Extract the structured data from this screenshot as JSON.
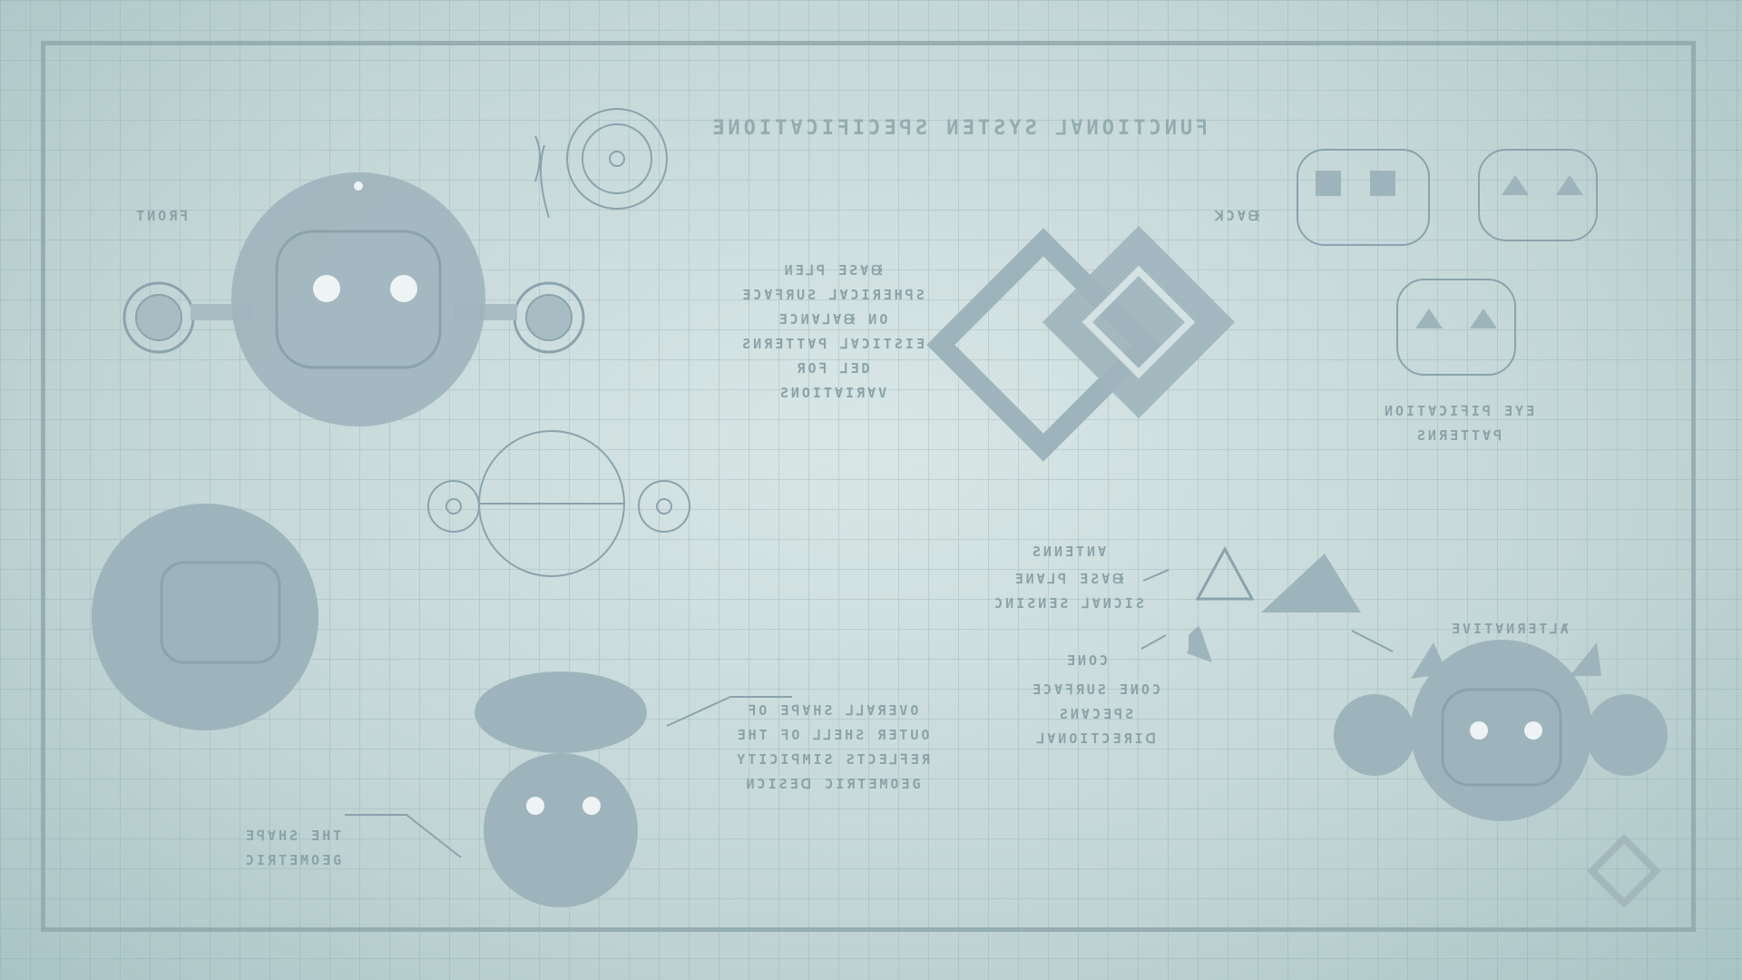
{
  "colors": {
    "background": "#c9dbdb",
    "grid": "#9fb8bb",
    "ink": "#8aa3a8",
    "frame": "#8fa8ab"
  },
  "labels": {
    "title": "ƎИOΙTⱯƆIꟻIƆƎꟼƧ ИƎTƧYƧ ⅃ⱯИOΙTƆИUꟻ",
    "front_view": "TИOЯꟻ",
    "back_view": "ꓘƆⱯᙠ",
    "center_note": "ИƎ⅃ꟼ ƎƧⱯᙠ\nƎƆⱯꟻЯUƧ ⅃ⱯƆIЯƎHꟼƧ\nƎƆИⱯ⅃Ɐᙠ ИO\nƧИЯƎTTⱯꟼ ⅃ⱯƆITƧIƎ\nЯOꟻ ⅃ƎD\nƧИOITⱯIЯⱯV",
    "eye_note": "ИOITⱯƆIꟻIꟼ ƎYƎ\nƧИЯƎTTⱯꟼ",
    "antenna_label": "ƧИИƎTИⱯ",
    "antenna_note": "ƎИⱯ⅃ꟼ ƎƧⱯᙠ\nƆИIƧИƎƧ ⅃ⱯИƆIƧ",
    "cone_label": "ƎИOƆ",
    "cone_note": "ƎƆⱯꟻЯUƧ ƎИOƆ\nƧИⱯƆƎꟼƧ ⅃ⱯИOITƆƎЯIᗡ",
    "split_note": "ꟻO ƎꟼⱯHƧ ⅃⅃ⱯЯƎVO\nƎHT ꟻO ⅃⅃ƎHƧ ЯƎTUO\nYTIƆIꟼMIƧ ƧTƆƎ⅃ꟻƎЯ\nИƆIƧƎᗡ ƆIЯTƎMOƎG",
    "base_note": "ƎꟼⱯHƧ ƎHT\nƆIЯTƎMOƎG",
    "variant_label": "ƎVITⱯИЯƎT⅃Ⱥ"
  }
}
